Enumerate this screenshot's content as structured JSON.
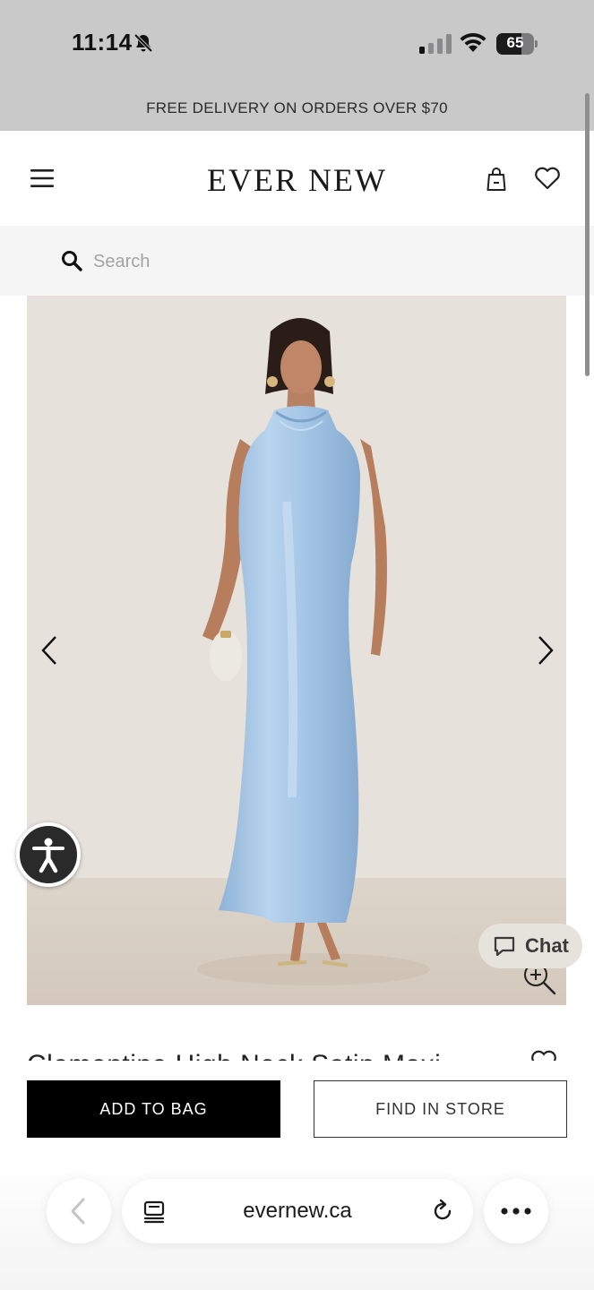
{
  "status_bar": {
    "time": "11:14",
    "battery": "65"
  },
  "promo": {
    "text": "FREE DELIVERY ON ORDERS OVER $70"
  },
  "header": {
    "brand": "EVER NEW"
  },
  "search": {
    "placeholder": "Search"
  },
  "product": {
    "title": "Clementine High Neck Satin Maxi"
  },
  "chat": {
    "label": "Chat"
  },
  "actions": {
    "add_to_bag": "ADD TO BAG",
    "find_in_store": "FIND IN STORE"
  },
  "browser": {
    "url": "evernew.ca"
  },
  "colors": {
    "dress": "#a9cbe9",
    "primary_button": "#000000",
    "top_bar": "#c9c9ca"
  }
}
